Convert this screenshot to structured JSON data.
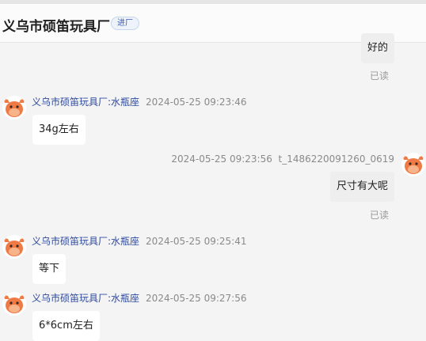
{
  "header": {
    "shop_name": "义乌市硕笛玩具厂",
    "tag": "进厂"
  },
  "messages": [
    {
      "side": "right",
      "text": "好的",
      "status": "已读"
    },
    {
      "side": "left",
      "sender": "义乌市硕笛玩具厂:水瓶座",
      "time": "2024-05-25 09:23:46",
      "text": "34g左右"
    },
    {
      "side": "right",
      "time": "2024-05-25 09:23:56",
      "sender": "t_1486220091260_0619",
      "text": "尺寸有大呢",
      "status": "已读"
    },
    {
      "side": "left",
      "sender": "义乌市硕笛玩具厂:水瓶座",
      "time": "2024-05-25 09:25:41",
      "text": "等下"
    },
    {
      "side": "left",
      "sender": "义乌市硕笛玩具厂:水瓶座",
      "time": "2024-05-25 09:27:56",
      "text": "6*6cm左右"
    }
  ],
  "colors": {
    "background": "#f4f4f4",
    "sender": "#2f4a9e",
    "avatar": "#f07a45"
  },
  "icons": {
    "avatar": "cow-mascot-icon"
  }
}
